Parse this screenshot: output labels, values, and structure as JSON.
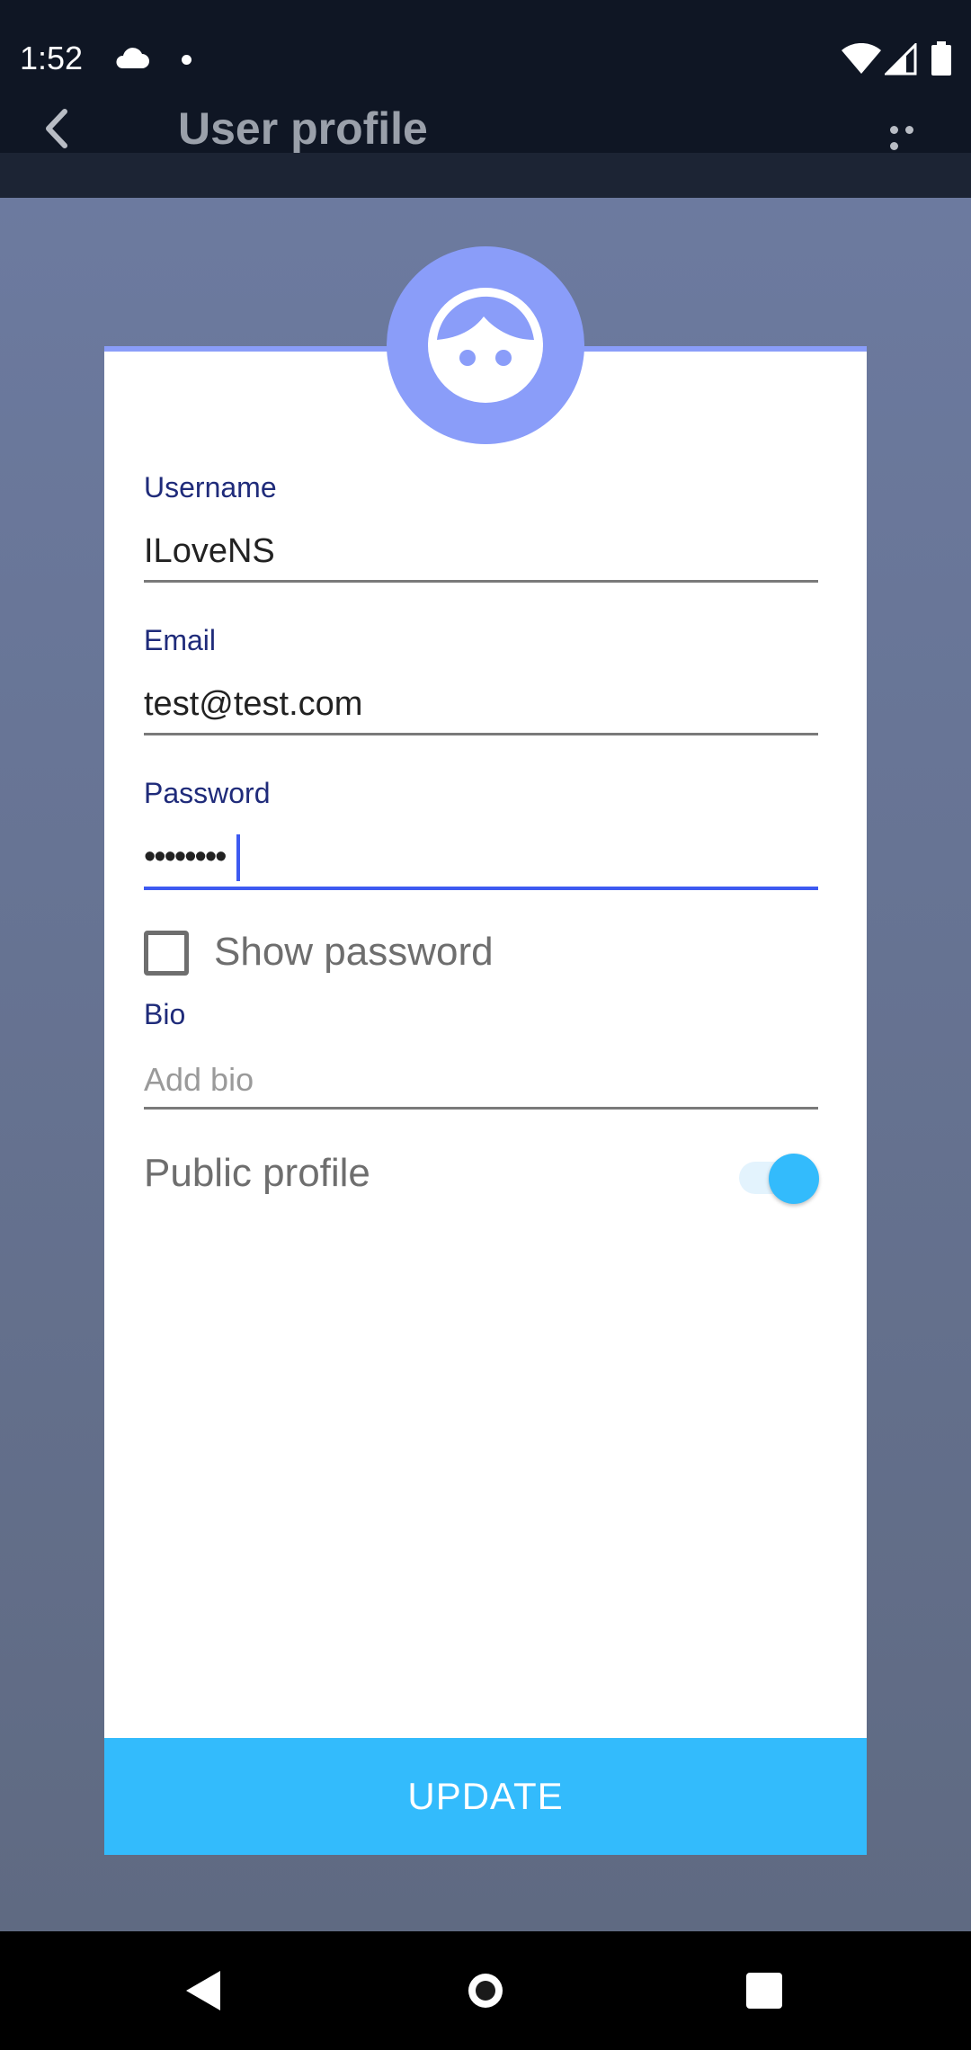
{
  "status_bar": {
    "time": "1:52",
    "icons": [
      "cloud-icon",
      "notification-dot-icon",
      "wifi-icon",
      "signal-icon",
      "battery-icon"
    ]
  },
  "app_bar": {
    "title": "User profile",
    "back_icon": "chevron-left-icon",
    "more_icon": "more-horizontal-icon"
  },
  "profile": {
    "avatar_icon": "face-icon",
    "username_label": "Username",
    "username_value": "ILoveNS",
    "email_label": "Email",
    "email_value": "test@test.com",
    "password_label": "Password",
    "password_value": "••••••••",
    "show_password_label": "Show password",
    "show_password_checked": false,
    "bio_label": "Bio",
    "bio_placeholder": "Add bio",
    "public_profile_label": "Public profile",
    "public_profile_enabled": true,
    "update_label": "UPDATE"
  },
  "colors": {
    "accent": "#3d5af1",
    "avatar": "#8a9df9",
    "button": "#33bbfc",
    "label": "#1f2b7a"
  },
  "nav_bar": {
    "icons": [
      "nav-back-icon",
      "nav-home-icon",
      "nav-recents-icon"
    ]
  }
}
